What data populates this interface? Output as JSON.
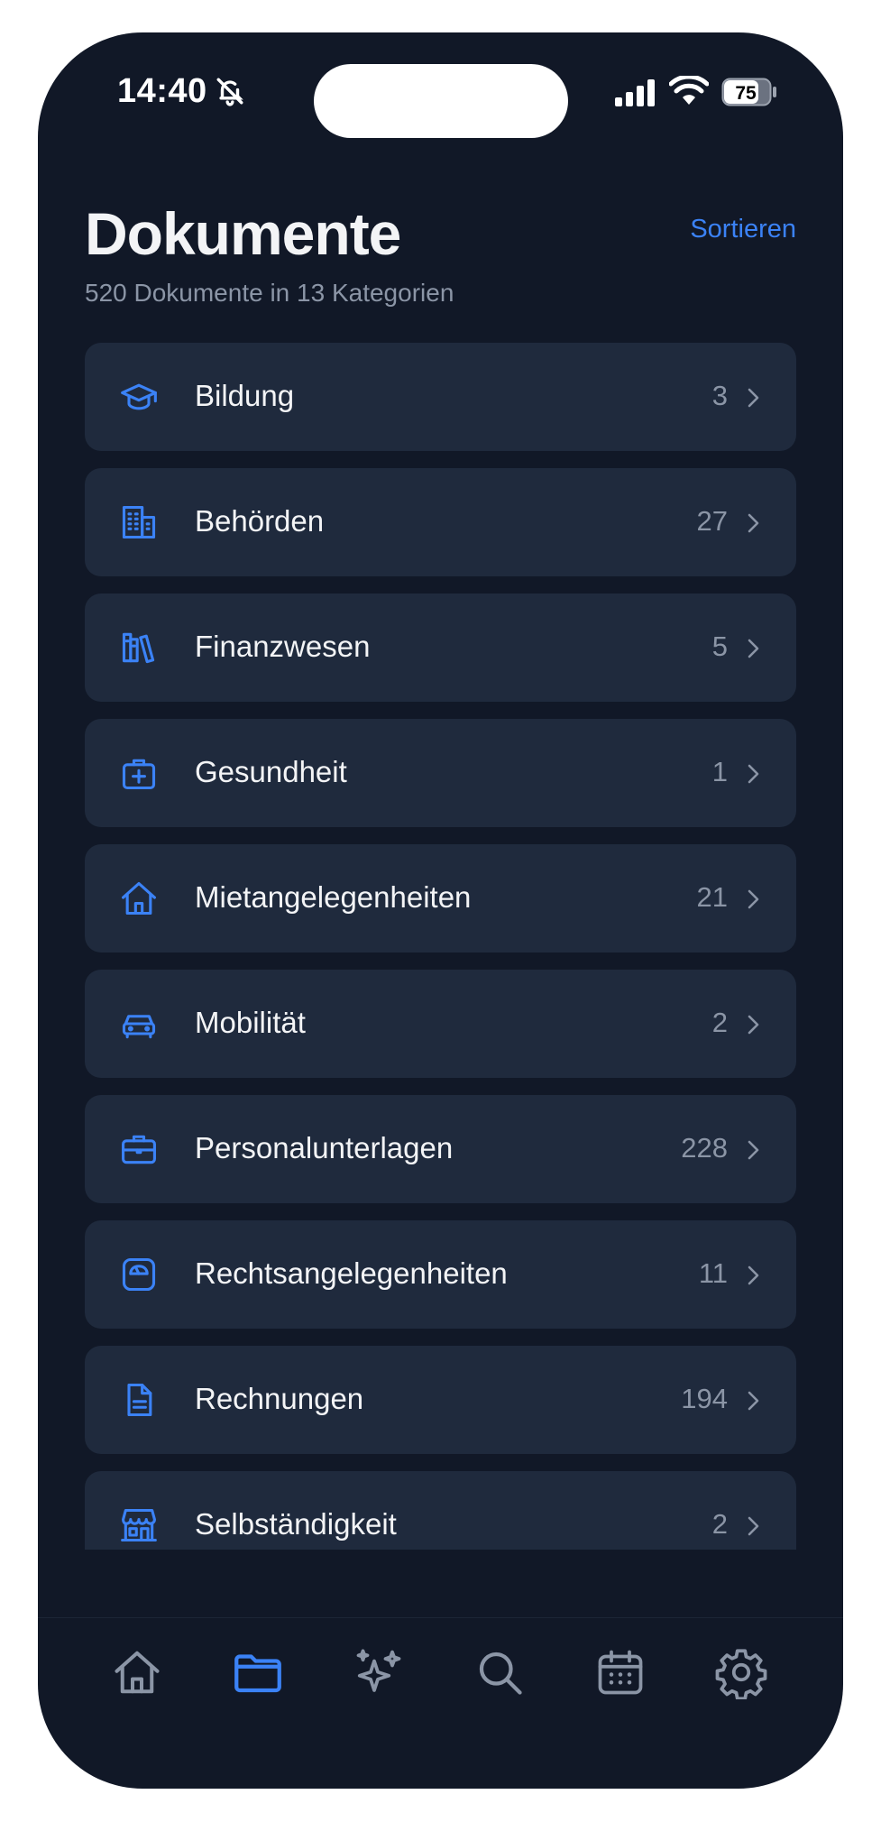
{
  "status_bar": {
    "time": "14:40",
    "battery": "75"
  },
  "header": {
    "title": "Dokumente",
    "sort_label": "Sortieren",
    "subtitle": "520 Dokumente in 13 Kategorien"
  },
  "categories": [
    {
      "label": "Bildung",
      "count": "3",
      "icon": "graduation-cap-icon"
    },
    {
      "label": "Behörden",
      "count": "27",
      "icon": "building-icon"
    },
    {
      "label": "Finanzwesen",
      "count": "5",
      "icon": "books-icon"
    },
    {
      "label": "Gesundheit",
      "count": "1",
      "icon": "medical-kit-icon"
    },
    {
      "label": "Mietangelegenheiten",
      "count": "21",
      "icon": "house-icon"
    },
    {
      "label": "Mobilität",
      "count": "2",
      "icon": "car-icon"
    },
    {
      "label": "Personalunterlagen",
      "count": "228",
      "icon": "briefcase-icon"
    },
    {
      "label": "Rechtsangelegenheiten",
      "count": "11",
      "icon": "scale-icon"
    },
    {
      "label": "Rechnungen",
      "count": "194",
      "icon": "document-icon"
    },
    {
      "label": "Selbständigkeit",
      "count": "2",
      "icon": "storefront-icon"
    }
  ],
  "tab_bar": {
    "items": [
      {
        "name": "home",
        "icon": "home-icon",
        "active": false
      },
      {
        "name": "documents",
        "icon": "folder-icon",
        "active": true
      },
      {
        "name": "ai",
        "icon": "sparkles-icon",
        "active": false
      },
      {
        "name": "search",
        "icon": "search-icon",
        "active": false
      },
      {
        "name": "calendar",
        "icon": "calendar-icon",
        "active": false
      },
      {
        "name": "settings",
        "icon": "gear-icon",
        "active": false
      }
    ]
  },
  "colors": {
    "background": "#111827",
    "card": "#1f2a3d",
    "accent": "#3b82f6",
    "text": "#f3f4f6",
    "muted": "#8b95a6"
  }
}
